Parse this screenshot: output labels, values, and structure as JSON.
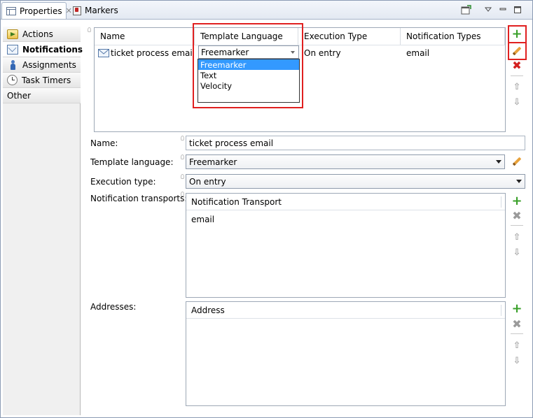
{
  "tabs": {
    "properties": "Properties",
    "markers": "Markers"
  },
  "categories": [
    {
      "label": "Actions",
      "icon": "actions-icon"
    },
    {
      "label": "Notifications",
      "icon": "mail-icon",
      "selected": true
    },
    {
      "label": "Assignments",
      "icon": "person-icon"
    },
    {
      "label": "Task Timers",
      "icon": "timer-icon"
    },
    {
      "label": "Other",
      "icon": ""
    }
  ],
  "notifications_table": {
    "columns": [
      "Name",
      "Template Language",
      "Execution Type",
      "Notification Types"
    ],
    "rows": [
      {
        "name": "ticket process email",
        "template_language": "Freemarker",
        "execution_type": "On entry",
        "notification_types": "email"
      }
    ]
  },
  "template_language_options": [
    "Freemarker",
    "Text",
    "Velocity"
  ],
  "template_language_selected": "Freemarker",
  "form": {
    "name_label": "Name:",
    "name_value": "ticket process email",
    "template_language_label": "Template language:",
    "template_language_value": "Freemarker",
    "execution_type_label": "Execution type:",
    "execution_type_value": "On entry",
    "transports_label": "Notification transports:",
    "transports_column": "Notification Transport",
    "transports": [
      "email"
    ],
    "addresses_label": "Addresses:",
    "addresses_column": "Address",
    "addresses": []
  },
  "colors": {
    "highlight_box": "#e02020",
    "selection": "#3399ff",
    "add_green": "#3aa02a",
    "remove_red": "#d42020"
  }
}
